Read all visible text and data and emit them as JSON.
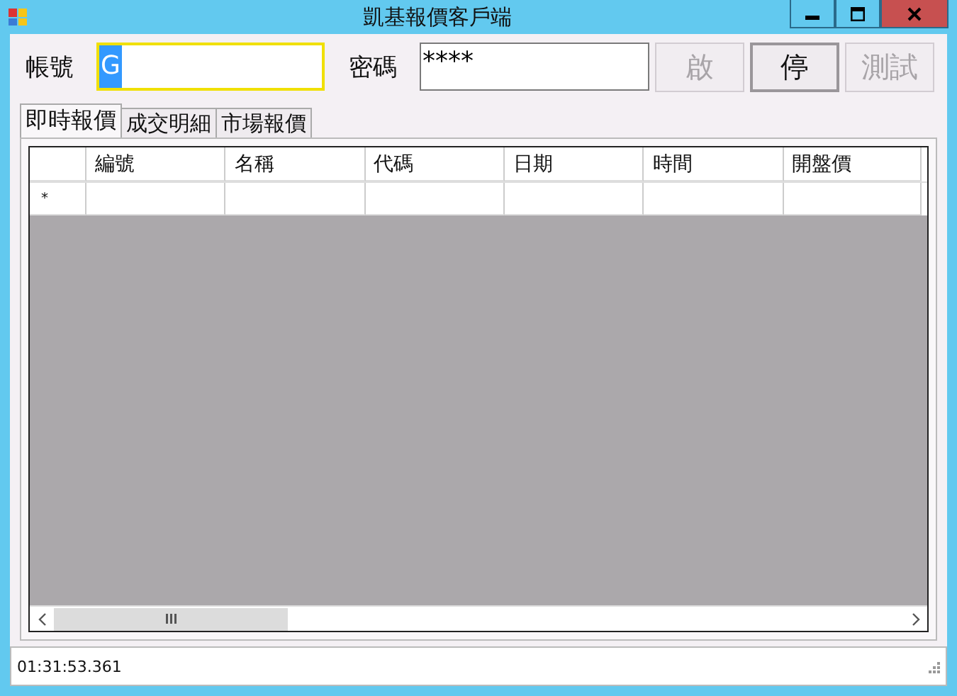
{
  "window": {
    "title": "凱基報價客戶端"
  },
  "login": {
    "account_label": "帳號",
    "account_value": "G",
    "password_label": "密碼",
    "password_value": "****"
  },
  "buttons": [
    {
      "label": "啟",
      "disabled": true
    },
    {
      "label": "停",
      "disabled": false
    },
    {
      "label": "測試",
      "disabled": true
    }
  ],
  "tabs": [
    {
      "label": "即時報價",
      "selected": true
    },
    {
      "label": "成交明細",
      "selected": false
    },
    {
      "label": "市場報價",
      "selected": false
    }
  ],
  "table": {
    "columns": [
      "編號",
      "名稱",
      "代碼",
      "日期",
      "時間",
      "開盤價"
    ],
    "new_row_marker": "*"
  },
  "status_bar": {
    "time": "01:31:53.361"
  }
}
